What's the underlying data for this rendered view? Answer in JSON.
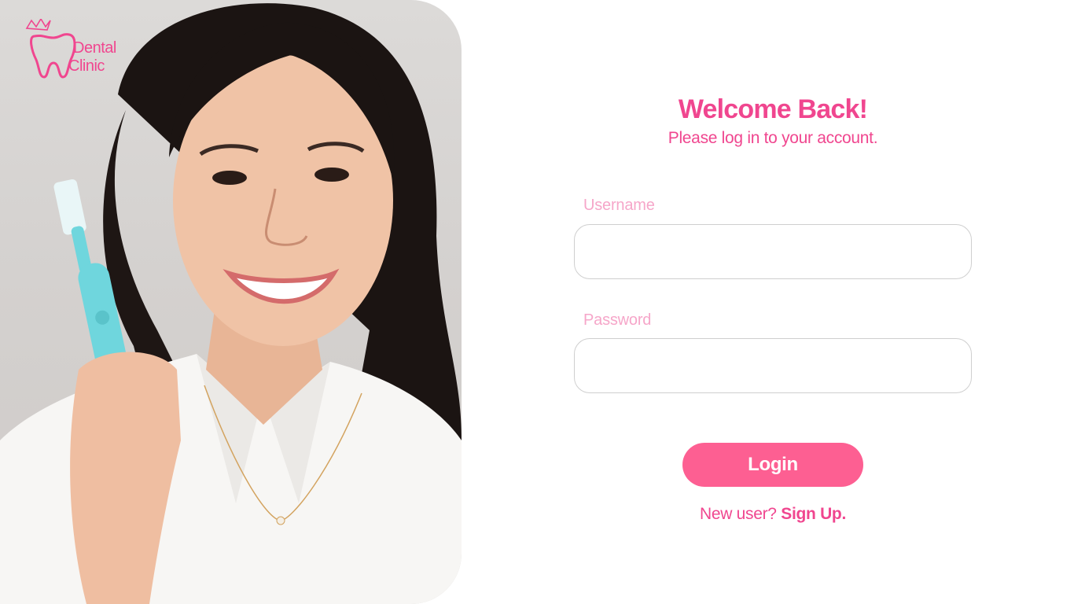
{
  "brand": {
    "line1": "Dental",
    "line2": "Clinic",
    "accent_color": "#f0468f",
    "icon": "tooth-with-crown-icon"
  },
  "hero": {
    "image": "smiling-woman-holding-toothbrush-photo"
  },
  "login": {
    "title": "Welcome Back!",
    "subtitle": "Please log in to your account.",
    "username_label": "Username",
    "username_value": "",
    "password_label": "Password",
    "password_value": "",
    "submit_label": "Login",
    "button_color": "#fd5f92",
    "new_user_text": "New user?",
    "signup_link": "Sign Up."
  }
}
